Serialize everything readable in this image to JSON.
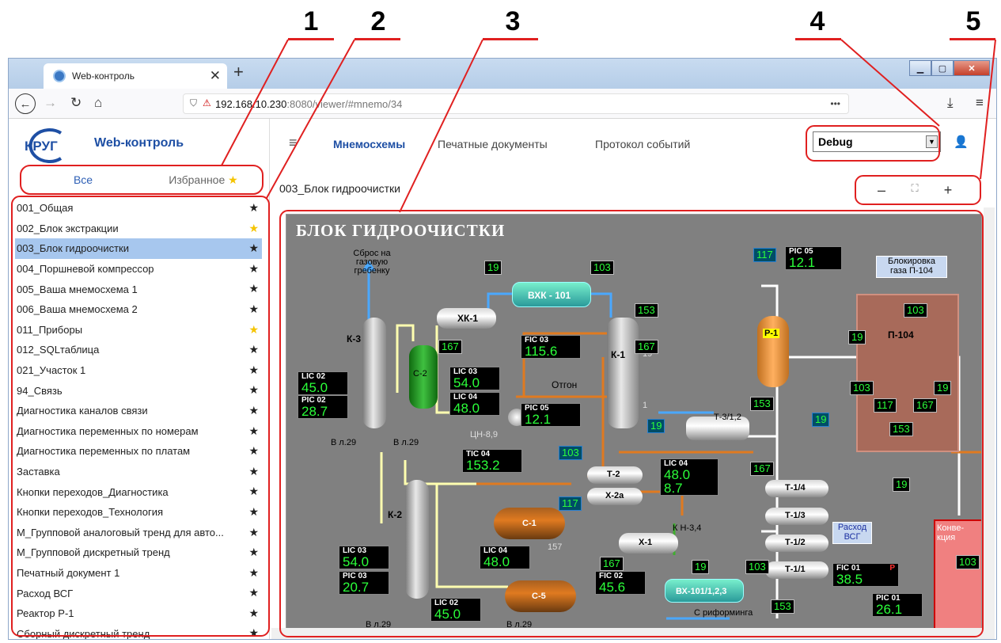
{
  "callouts": [
    "1",
    "2",
    "3",
    "4",
    "5"
  ],
  "browser": {
    "tab_title": "Web-контроль",
    "new_tab": "+",
    "url_host": "192.168.10.230",
    "url_path": ":8080/viewer/#mnemo/34",
    "more": "•••",
    "download": "⤓",
    "menu": "≡"
  },
  "app": {
    "logo_text": "КРУГ",
    "title": "Web-контроль",
    "tabs": {
      "all": "Все",
      "favorites": "Избранное"
    },
    "nav": {
      "menu_icon": "≡",
      "schemes": "Мнемосхемы",
      "print_docs": "Печатные документы",
      "events": "Протокол событий"
    },
    "mode_select": "Debug",
    "breadcrumb": "003_Блок гидроочистки",
    "zoom": {
      "out": "–",
      "fit": "⛶",
      "in": "+"
    }
  },
  "scheme_list": [
    {
      "name": "001_Общая",
      "fav": false
    },
    {
      "name": "002_Блок экстракции",
      "fav": true
    },
    {
      "name": "003_Блок гидроочистки",
      "fav": false,
      "selected": true
    },
    {
      "name": "004_Поршневой компрессор",
      "fav": false
    },
    {
      "name": "005_Ваша мнемосхема 1",
      "fav": false
    },
    {
      "name": "006_Ваша мнемосхема 2",
      "fav": false
    },
    {
      "name": "011_Приборы",
      "fav": true
    },
    {
      "name": "012_SQLтаблица",
      "fav": false
    },
    {
      "name": "021_Участок 1",
      "fav": false
    },
    {
      "name": "94_Связь",
      "fav": false
    },
    {
      "name": "Диагностика каналов связи",
      "fav": false
    },
    {
      "name": "Диагностика переменных по номерам",
      "fav": false
    },
    {
      "name": "Диагностика переменных по платам",
      "fav": false
    },
    {
      "name": "Заставка",
      "fav": false
    },
    {
      "name": "Кнопки переходов_Диагностика",
      "fav": false
    },
    {
      "name": "Кнопки переходов_Технология",
      "fav": false
    },
    {
      "name": "М_Групповой аналоговый тренд для авто...",
      "fav": false
    },
    {
      "name": "М_Групповой дискретный тренд",
      "fav": false
    },
    {
      "name": "Печатный документ 1",
      "fav": false
    },
    {
      "name": "Расход ВСГ",
      "fav": false
    },
    {
      "name": "Реактор Р-1",
      "fav": false
    },
    {
      "name": "Сборный дискретный тренд",
      "fav": false
    }
  ],
  "star": "★",
  "scheme": {
    "title": "БЛОК ГИДРООЧИСТКИ",
    "labels": {
      "sbros": "Сброс на\nгазовую\nгребенку",
      "k3": "К-3",
      "k2": "К-2",
      "k1": "К-1",
      "c2": "С-2",
      "c1": "С-1",
      "c5": "С-5",
      "xk1": "ХК-1",
      "vxk": "ВХК - 101",
      "otgon": "Отгон",
      "cn": "ЦН-8,9",
      "t32": "Т-3/1,2",
      "t2": "Т-2",
      "x2a": "Х-2а",
      "x1": "Х-1",
      "kn": "К Н-3,4",
      "vx": "ВХ-101/1,2,3",
      "reforming": "С риформинга",
      "p1": "Р-1",
      "p104": "П-104",
      "t14": "Т-1/4",
      "t13": "Т-1/3",
      "t12": "Т-1/2",
      "t11": "Т-1/1",
      "block": "Блокировка\nгаза П-104",
      "rashod": "Расход\nВСГ",
      "konv": "Конве-\nкция",
      "vl29a": "В л.29",
      "vl29b": "В л.29",
      "vl29c": "В л.29",
      "vl29d": "В л.29",
      "k1_19": "19",
      "k1_1": "1",
      "n157": "157"
    },
    "instruments": {
      "lic02a": {
        "tag": "LIC 02",
        "val": "45.0"
      },
      "pic02": {
        "tag": "PIC 02",
        "val": "28.7"
      },
      "lic03a": {
        "tag": "LIC 03",
        "val": "54.0"
      },
      "lic04a": {
        "tag": "LIC 04",
        "val": "48.0"
      },
      "fic03": {
        "tag": "FIC 03",
        "val": "115.6"
      },
      "pic05a": {
        "tag": "PIC 05",
        "val": "12.1"
      },
      "pic05b": {
        "tag": "PIC 05",
        "val": "12.1"
      },
      "tic04": {
        "tag": "TIC 04",
        "val": "153.2"
      },
      "lic04b": {
        "tag": "LIC 04",
        "val": "48.0",
        "val2": "8.7"
      },
      "lic03b": {
        "tag": "LIC 03",
        "val": "54.0"
      },
      "pic03": {
        "tag": "PIC 03",
        "val": "20.7"
      },
      "lic04c": {
        "tag": "LIC 04",
        "val": "48.0"
      },
      "lic02b": {
        "tag": "LIC 02",
        "val": "45.0"
      },
      "fic02": {
        "tag": "FIC 02",
        "val": "45.6"
      },
      "fic01": {
        "tag": "FIC 01",
        "val": "38.5",
        "flag": "P"
      },
      "pic01": {
        "tag": "PIC 01",
        "val": "26.1"
      }
    },
    "values": {
      "v19a": "19",
      "v103a": "103",
      "v153a": "153",
      "v167a": "167",
      "v167b": "167",
      "v117a": "117",
      "v19b": "19",
      "v153b": "153",
      "v19c": "19",
      "v103b": "103",
      "v117b": "117",
      "v167c": "167",
      "v167d": "167",
      "v19d": "19",
      "v103c": "103",
      "v153c": "153",
      "v103p1": "103",
      "v19p1": "19",
      "v103p2": "103",
      "v19p2": "19",
      "v117p": "117",
      "v167p": "167",
      "v153p": "153",
      "v19e": "19",
      "v103k": "103"
    }
  }
}
